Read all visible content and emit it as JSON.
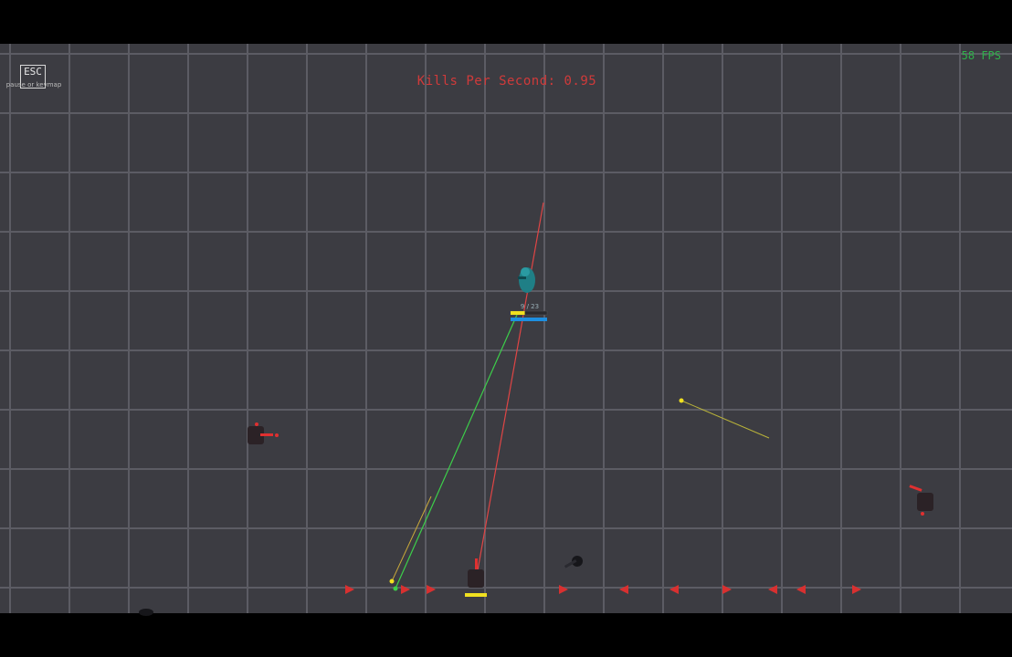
{
  "hud": {
    "esc_label": "ESC",
    "esc_hint": "pause or keymap",
    "kills_per_second": "Kills Per Second: 0.95",
    "fps": "58 FPS"
  },
  "player": {
    "ammo": "9 / 23",
    "ammo_fraction": 0.39,
    "health_fraction": 1.0
  },
  "colors": {
    "background_bar": "#000000",
    "arena": "#3c3c42",
    "grid_line": "#5c5c64",
    "player": "#1f7f86",
    "enemy": "#2b2226",
    "enemy_accent": "#e03030",
    "laser_red": "#e04545",
    "laser_green": "#3ccf4a",
    "tracer_yellow": "#c9c23a",
    "health_bar": "#1e8fe0",
    "ammo_bar": "#f0e020",
    "kps_text": "#d03a3a",
    "fps_text": "#2fb24a"
  }
}
